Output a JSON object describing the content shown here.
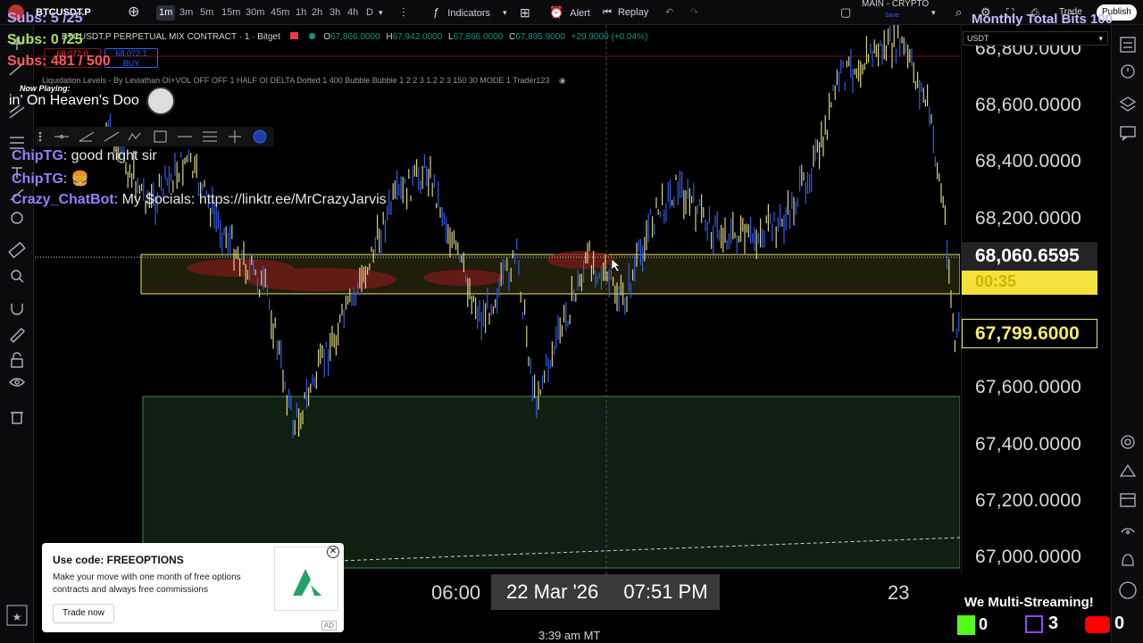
{
  "topbar": {
    "symbol": "BTCUSDT.P",
    "timeframes": [
      "1m",
      "3m",
      "5m",
      "15m",
      "30m",
      "45m",
      "1h",
      "2h",
      "3h",
      "4h",
      "D"
    ],
    "active_timeframe": "1m",
    "indicators_label": "Indicators",
    "alert_label": "Alert",
    "replay_label": "Replay",
    "layout_name": "MAIN - CRYPTO",
    "layout_status": "Save",
    "trade_label": "Trade",
    "publish_label": "Publish"
  },
  "legend": {
    "contract": "BTCUSDT.P PERPETUAL MIX CONTRACT · 1 · Bitget",
    "ohlc": {
      "o": "67,866.0000",
      "h": "67,942.0000",
      "l": "67,866.0000",
      "c": "67,895.9000",
      "change": "+29.9000 (+0.04%)"
    },
    "sell_price": "68,072.0",
    "buy_price": "68,072.1",
    "buy_label": "BUY",
    "indicator_line": "Liquidation Levels - By Leviathan OI+VOL OFF OFF 1 HALF OI DELTA Dotted 1 400 Bubble Bubble 1 2 2 3 1.2 2 3 150 30 MODE 1 Trader123"
  },
  "currency_select": "USDT",
  "price_scale": {
    "labels": [
      "68,800.0000",
      "68,600.0000",
      "68,400.0000",
      "68,200.0000",
      "67,600.0000",
      "67,400.0000",
      "67,200.0000",
      "67,000.0000"
    ],
    "label_values": [
      68800,
      68600,
      68400,
      68200,
      67600,
      67400,
      67200,
      67000
    ],
    "current_price": "68,060.6595",
    "countdown": "00:35",
    "other_price": "67,799.6000"
  },
  "time_scale": {
    "labels": [
      "06:00",
      "23"
    ],
    "crosshair_date": "22 Mar '26",
    "crosshair_time": "07:51 PM",
    "clock": "3:39 am MT"
  },
  "stream_overlay": {
    "subs1": "Subs: 5 /25",
    "subs2": "Subs: 0 /25",
    "subs3": "Subs: 481 / 500",
    "now_playing_label": "Now Playing:",
    "now_playing_track": "in' On Heaven's Doo",
    "bits_goal": "Monthly Total Bits 100",
    "chat": [
      {
        "user": "ChipTG",
        "text": ": good night sir"
      },
      {
        "user": "ChipTG",
        "text": ": 🍔"
      },
      {
        "user": "Crazy_ChatBot",
        "text": ": My Socials: https://linktr.ee/MrCrazyJarvis"
      }
    ],
    "multistream": "We Multi-Streaming!",
    "kick_count": "0",
    "twitch_count": "3",
    "youtube_count": "0"
  },
  "ad": {
    "title": "Use code: FREEOPTIONS",
    "body": "Make your move with one month of free options contracts and always free commissions",
    "cta": "Trade now",
    "badge": "AD"
  },
  "colors": {
    "accent": "#2962ff",
    "candle_up": "#2f5fe8",
    "candle_down": "#d9d27a",
    "zone_yellow": "#f5e13c",
    "zone_green": "#1e7a3a",
    "chat_user": "#9b7dff"
  }
}
